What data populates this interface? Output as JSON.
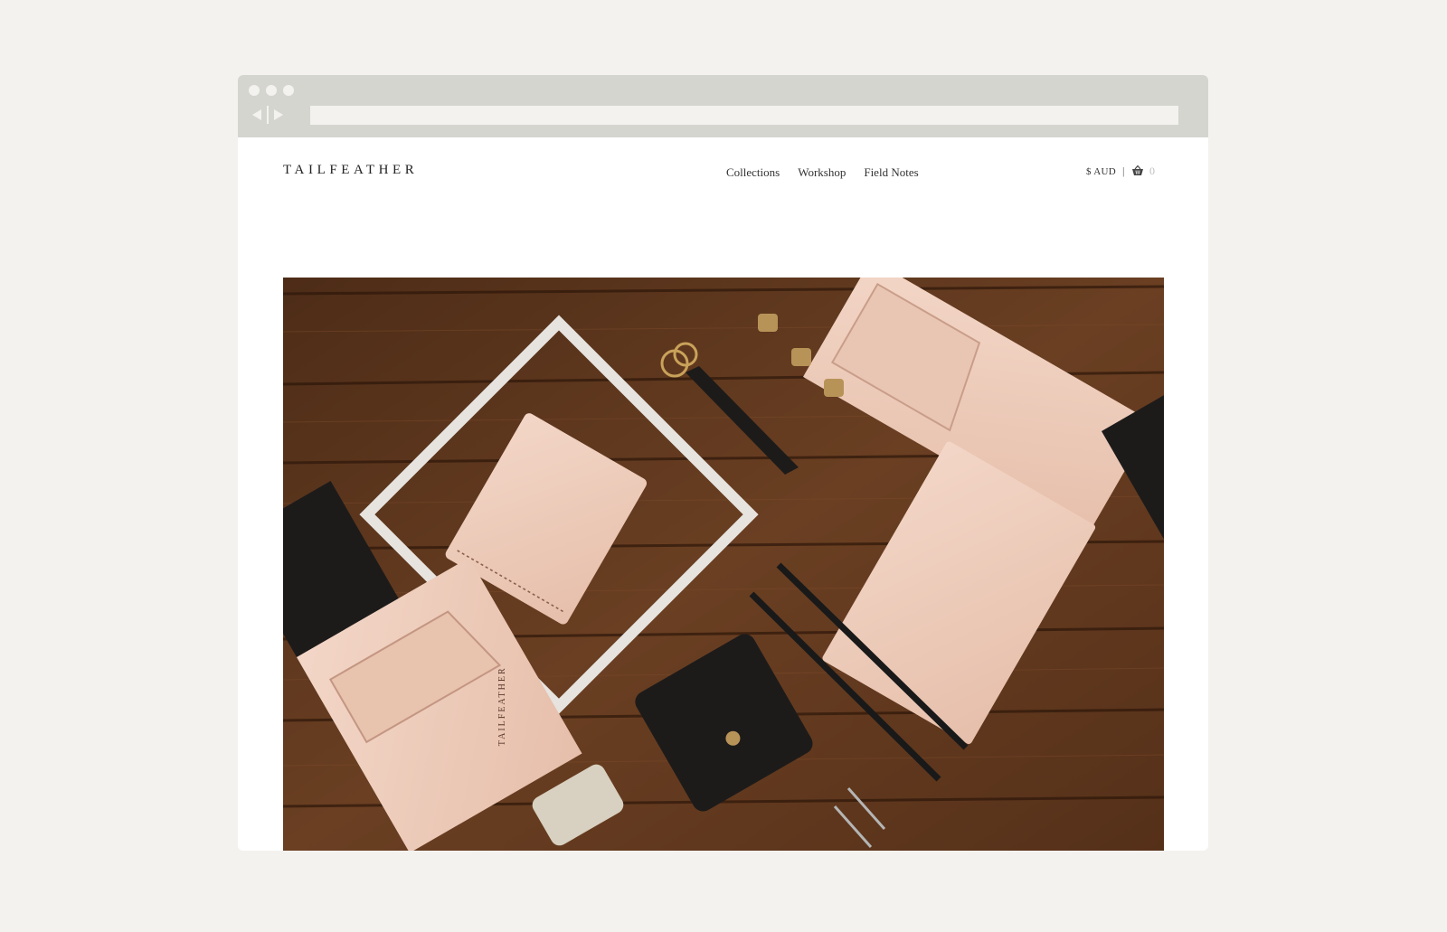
{
  "brand": {
    "name": "TAILFEATHER"
  },
  "nav": {
    "items": [
      {
        "label": "Collections"
      },
      {
        "label": "Workshop"
      },
      {
        "label": "Field Notes"
      }
    ]
  },
  "cart": {
    "currency": "$ AUD",
    "divider": "|",
    "icon": "basket-icon",
    "count": "0"
  },
  "browser_chrome": {
    "icons": [
      "window-dot-icon",
      "back-arrow-icon",
      "forward-arrow-icon"
    ]
  },
  "hero": {
    "image": "leather-goods-flatlay-photo",
    "stamp_text": "TAILFEATHER"
  },
  "colors": {
    "page_background": "#f3f2ef",
    "chrome": "#d5d5d0",
    "wood": "#5a341d",
    "leather_natural": "#efcfbf",
    "leather_black": "#1d1b1a"
  }
}
